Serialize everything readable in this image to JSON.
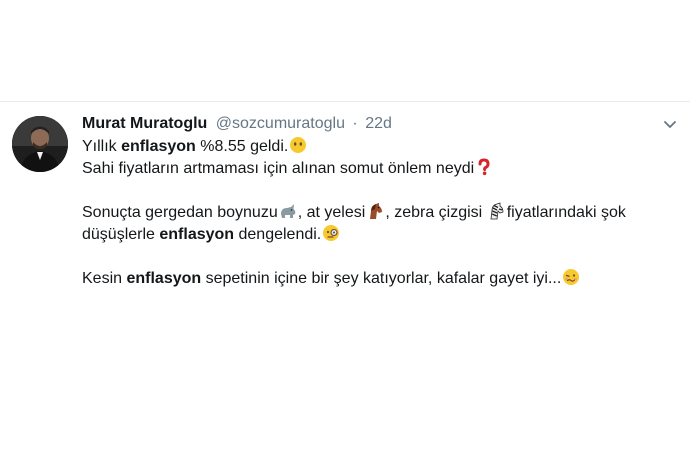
{
  "tweet": {
    "author_name": "Murat Muratoglu",
    "handle": "@sozcumuratoglu",
    "separator": "·",
    "time": "22d",
    "line1": {
      "pre": "Yıllık ",
      "bold": "enflasyon",
      "post": " %8.55 geldi."
    },
    "line2": {
      "text": "Sahi fiyatların artmaması için alınan somut önlem neydi"
    },
    "para2": {
      "t1": "Sonuçta gergedan boynuzu",
      "t2": ", at yelesi",
      "t3": ", zebra çizgisi ",
      "t4": "fiyatlarındaki şok düşüşlerle ",
      "bold": "enflasyon",
      "t5": " dengelendi."
    },
    "para3": {
      "pre": "Kesin ",
      "bold": "enflasyon",
      "post": " sepetinin içine bir şey katıyorlar, kafalar gayet iyi..."
    },
    "emojis": [
      "face-without-mouth-emoji",
      "red-question-mark-emoji",
      "rhinoceros-emoji",
      "horse-emoji",
      "zebra-emoji",
      "face-with-monocle-emoji",
      "woozy-face-emoji"
    ]
  },
  "colors": {
    "name": "#14171a",
    "secondary": "#657786",
    "divider": "#e6ecf0"
  }
}
